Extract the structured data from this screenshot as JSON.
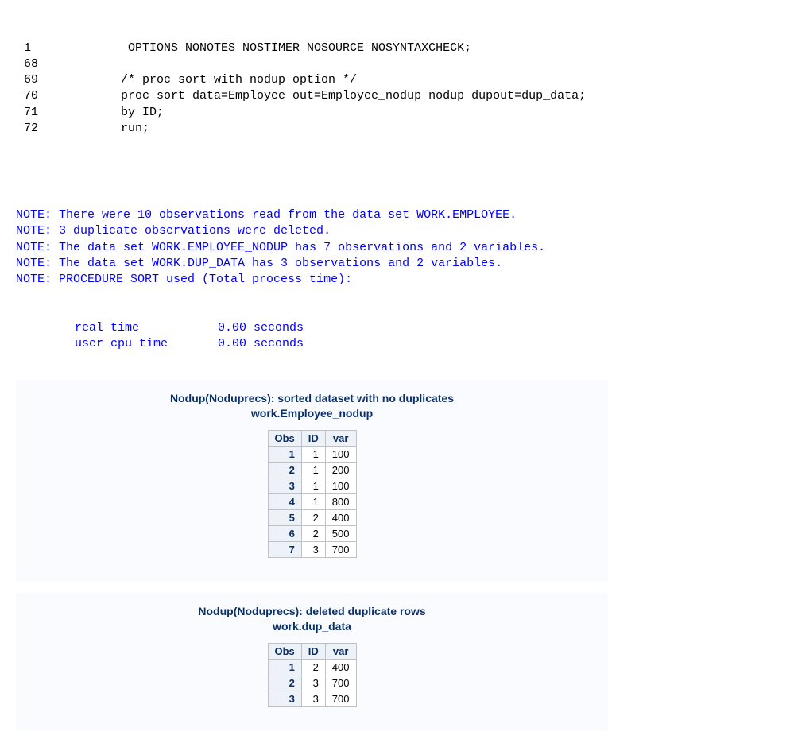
{
  "log": {
    "lines": [
      {
        "no": "1",
        "code": "    OPTIONS NONOTES NOSTIMER NOSOURCE NOSYNTAXCHECK;"
      },
      {
        "no": "68",
        "code": ""
      },
      {
        "no": "69",
        "code": "/* proc sort with nodup option */"
      },
      {
        "no": "70",
        "code": "proc sort data=Employee out=Employee_nodup nodup dupout=dup_data;"
      },
      {
        "no": "71",
        "code": "by ID;"
      },
      {
        "no": "72",
        "code": "run;"
      }
    ],
    "notes": [
      "NOTE: There were 10 observations read from the data set WORK.EMPLOYEE.",
      "NOTE: 3 duplicate observations were deleted.",
      "NOTE: The data set WORK.EMPLOYEE_NODUP has 7 observations and 2 variables.",
      "NOTE: The data set WORK.DUP_DATA has 3 observations and 2 variables.",
      "NOTE: PROCEDURE SORT used (Total process time):"
    ],
    "timing": [
      {
        "label": "real time",
        "value": "0.00 seconds"
      },
      {
        "label": "user cpu time",
        "value": "0.00 seconds"
      }
    ]
  },
  "output1": {
    "title_line1": "Nodup(Noduprecs): sorted dataset with no duplicates",
    "title_line2": "work.Employee_nodup",
    "headers": [
      "Obs",
      "ID",
      "var"
    ],
    "rows": [
      {
        "obs": "1",
        "id": "1",
        "var": "100"
      },
      {
        "obs": "2",
        "id": "1",
        "var": "200"
      },
      {
        "obs": "3",
        "id": "1",
        "var": "100"
      },
      {
        "obs": "4",
        "id": "1",
        "var": "800"
      },
      {
        "obs": "5",
        "id": "2",
        "var": "400"
      },
      {
        "obs": "6",
        "id": "2",
        "var": "500"
      },
      {
        "obs": "7",
        "id": "3",
        "var": "700"
      }
    ]
  },
  "output2": {
    "title_line1": "Nodup(Noduprecs): deleted duplicate rows",
    "title_line2": "work.dup_data",
    "headers": [
      "Obs",
      "ID",
      "var"
    ],
    "rows": [
      {
        "obs": "1",
        "id": "2",
        "var": "400"
      },
      {
        "obs": "2",
        "id": "3",
        "var": "700"
      },
      {
        "obs": "3",
        "id": "3",
        "var": "700"
      }
    ]
  }
}
